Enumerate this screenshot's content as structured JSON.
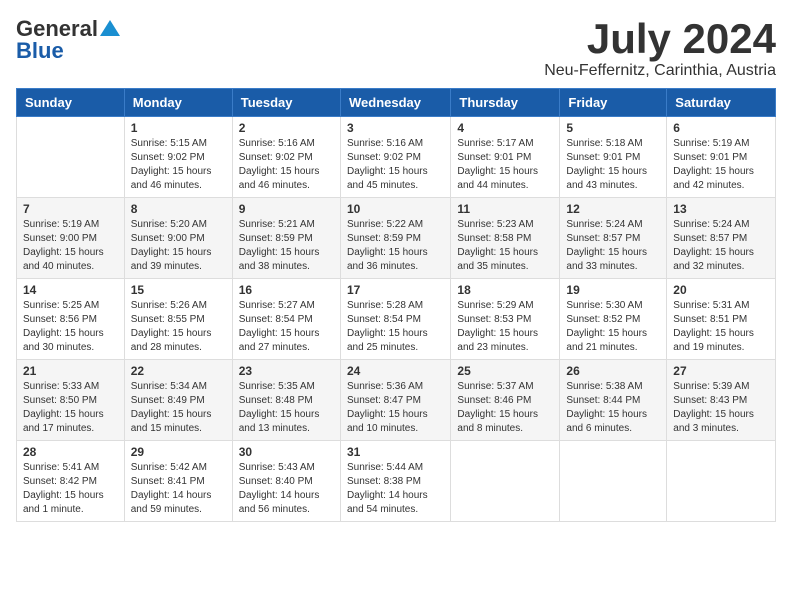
{
  "header": {
    "logo_general": "General",
    "logo_blue": "Blue",
    "month_title": "July 2024",
    "location": "Neu-Feffernitz, Carinthia, Austria"
  },
  "days_of_week": [
    "Sunday",
    "Monday",
    "Tuesday",
    "Wednesday",
    "Thursday",
    "Friday",
    "Saturday"
  ],
  "weeks": [
    [
      {
        "day": "",
        "info": ""
      },
      {
        "day": "1",
        "info": "Sunrise: 5:15 AM\nSunset: 9:02 PM\nDaylight: 15 hours and 46 minutes."
      },
      {
        "day": "2",
        "info": "Sunrise: 5:16 AM\nSunset: 9:02 PM\nDaylight: 15 hours and 46 minutes."
      },
      {
        "day": "3",
        "info": "Sunrise: 5:16 AM\nSunset: 9:02 PM\nDaylight: 15 hours and 45 minutes."
      },
      {
        "day": "4",
        "info": "Sunrise: 5:17 AM\nSunset: 9:01 PM\nDaylight: 15 hours and 44 minutes."
      },
      {
        "day": "5",
        "info": "Sunrise: 5:18 AM\nSunset: 9:01 PM\nDaylight: 15 hours and 43 minutes."
      },
      {
        "day": "6",
        "info": "Sunrise: 5:19 AM\nSunset: 9:01 PM\nDaylight: 15 hours and 42 minutes."
      }
    ],
    [
      {
        "day": "7",
        "info": "Sunrise: 5:19 AM\nSunset: 9:00 PM\nDaylight: 15 hours and 40 minutes."
      },
      {
        "day": "8",
        "info": "Sunrise: 5:20 AM\nSunset: 9:00 PM\nDaylight: 15 hours and 39 minutes."
      },
      {
        "day": "9",
        "info": "Sunrise: 5:21 AM\nSunset: 8:59 PM\nDaylight: 15 hours and 38 minutes."
      },
      {
        "day": "10",
        "info": "Sunrise: 5:22 AM\nSunset: 8:59 PM\nDaylight: 15 hours and 36 minutes."
      },
      {
        "day": "11",
        "info": "Sunrise: 5:23 AM\nSunset: 8:58 PM\nDaylight: 15 hours and 35 minutes."
      },
      {
        "day": "12",
        "info": "Sunrise: 5:24 AM\nSunset: 8:57 PM\nDaylight: 15 hours and 33 minutes."
      },
      {
        "day": "13",
        "info": "Sunrise: 5:24 AM\nSunset: 8:57 PM\nDaylight: 15 hours and 32 minutes."
      }
    ],
    [
      {
        "day": "14",
        "info": "Sunrise: 5:25 AM\nSunset: 8:56 PM\nDaylight: 15 hours and 30 minutes."
      },
      {
        "day": "15",
        "info": "Sunrise: 5:26 AM\nSunset: 8:55 PM\nDaylight: 15 hours and 28 minutes."
      },
      {
        "day": "16",
        "info": "Sunrise: 5:27 AM\nSunset: 8:54 PM\nDaylight: 15 hours and 27 minutes."
      },
      {
        "day": "17",
        "info": "Sunrise: 5:28 AM\nSunset: 8:54 PM\nDaylight: 15 hours and 25 minutes."
      },
      {
        "day": "18",
        "info": "Sunrise: 5:29 AM\nSunset: 8:53 PM\nDaylight: 15 hours and 23 minutes."
      },
      {
        "day": "19",
        "info": "Sunrise: 5:30 AM\nSunset: 8:52 PM\nDaylight: 15 hours and 21 minutes."
      },
      {
        "day": "20",
        "info": "Sunrise: 5:31 AM\nSunset: 8:51 PM\nDaylight: 15 hours and 19 minutes."
      }
    ],
    [
      {
        "day": "21",
        "info": "Sunrise: 5:33 AM\nSunset: 8:50 PM\nDaylight: 15 hours and 17 minutes."
      },
      {
        "day": "22",
        "info": "Sunrise: 5:34 AM\nSunset: 8:49 PM\nDaylight: 15 hours and 15 minutes."
      },
      {
        "day": "23",
        "info": "Sunrise: 5:35 AM\nSunset: 8:48 PM\nDaylight: 15 hours and 13 minutes."
      },
      {
        "day": "24",
        "info": "Sunrise: 5:36 AM\nSunset: 8:47 PM\nDaylight: 15 hours and 10 minutes."
      },
      {
        "day": "25",
        "info": "Sunrise: 5:37 AM\nSunset: 8:46 PM\nDaylight: 15 hours and 8 minutes."
      },
      {
        "day": "26",
        "info": "Sunrise: 5:38 AM\nSunset: 8:44 PM\nDaylight: 15 hours and 6 minutes."
      },
      {
        "day": "27",
        "info": "Sunrise: 5:39 AM\nSunset: 8:43 PM\nDaylight: 15 hours and 3 minutes."
      }
    ],
    [
      {
        "day": "28",
        "info": "Sunrise: 5:41 AM\nSunset: 8:42 PM\nDaylight: 15 hours and 1 minute."
      },
      {
        "day": "29",
        "info": "Sunrise: 5:42 AM\nSunset: 8:41 PM\nDaylight: 14 hours and 59 minutes."
      },
      {
        "day": "30",
        "info": "Sunrise: 5:43 AM\nSunset: 8:40 PM\nDaylight: 14 hours and 56 minutes."
      },
      {
        "day": "31",
        "info": "Sunrise: 5:44 AM\nSunset: 8:38 PM\nDaylight: 14 hours and 54 minutes."
      },
      {
        "day": "",
        "info": ""
      },
      {
        "day": "",
        "info": ""
      },
      {
        "day": "",
        "info": ""
      }
    ]
  ]
}
